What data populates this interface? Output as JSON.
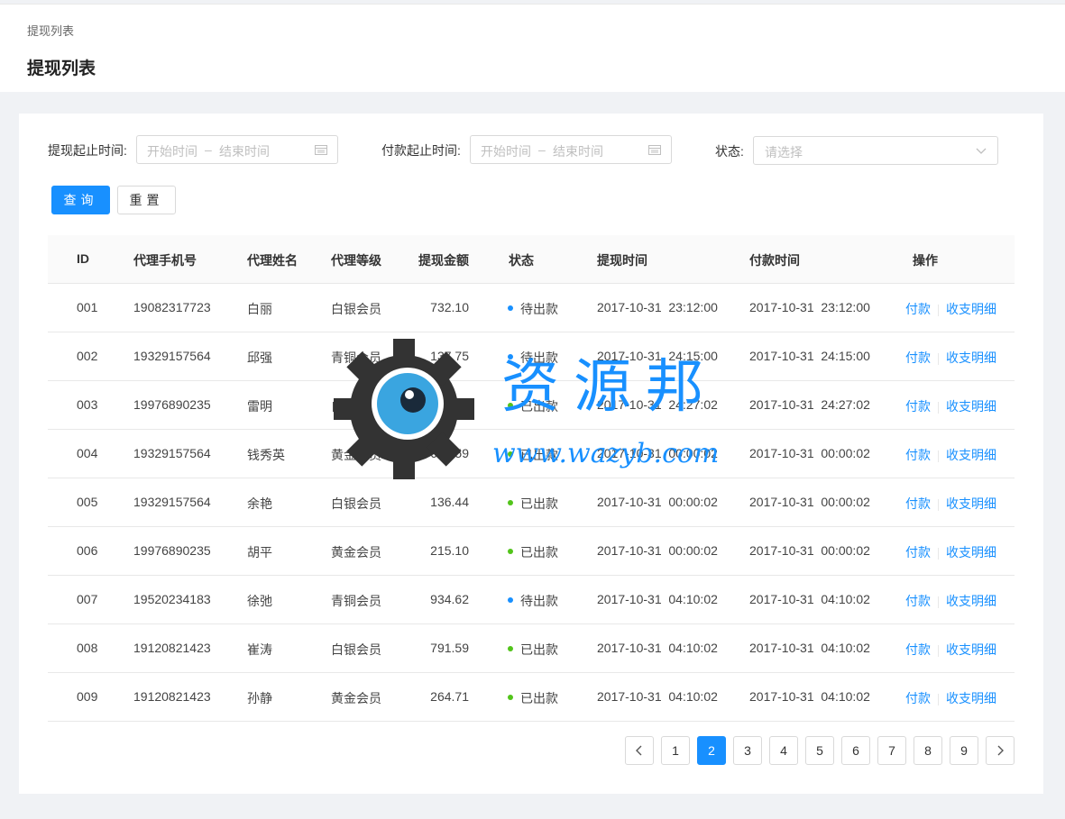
{
  "header": {
    "breadcrumb": "提现列表",
    "title": "提现列表"
  },
  "filters": {
    "withdraw_label": "提现起止时间:",
    "pay_label": "付款起止时间:",
    "status_label": "状态:",
    "start_placeholder": "开始时间",
    "separator": "–",
    "end_placeholder": "结束时间",
    "status_placeholder": "请选择"
  },
  "buttons": {
    "query": "查询",
    "reset": "重置"
  },
  "table": {
    "columns": [
      "ID",
      "代理手机号",
      "代理姓名",
      "代理等级",
      "提现金额",
      "状态",
      "提现时间",
      "付款时间",
      "操作"
    ],
    "rows": [
      {
        "id": "001",
        "phone": "19082317723",
        "name": "白丽",
        "level": "白银会员",
        "amount": "732.10",
        "status": "待出款",
        "status_color": "#1890ff",
        "withdraw_time": "2017-10-31  23:12:00",
        "pay_time": "2017-10-31  23:12:00"
      },
      {
        "id": "002",
        "phone": "19329157564",
        "name": "邱强",
        "level": "青铜会员",
        "amount": "137.75",
        "status": "待出款",
        "status_color": "#1890ff",
        "withdraw_time": "2017-10-31  24:15:00",
        "pay_time": "2017-10-31  24:15:00"
      },
      {
        "id": "003",
        "phone": "19976890235",
        "name": "雷明",
        "level": "白银会员",
        "amount": "405.98",
        "status": "已出款",
        "status_color": "#52c41a",
        "withdraw_time": "2017-10-31  24:27:02",
        "pay_time": "2017-10-31  24:27:02"
      },
      {
        "id": "004",
        "phone": "19329157564",
        "name": "钱秀英",
        "level": "黄金会员",
        "amount": "655.59",
        "status": "已出款",
        "status_color": "#52c41a",
        "withdraw_time": "2017-10-31  00:00:02",
        "pay_time": "2017-10-31  00:00:02"
      },
      {
        "id": "005",
        "phone": "19329157564",
        "name": "余艳",
        "level": "白银会员",
        "amount": "136.44",
        "status": "已出款",
        "status_color": "#52c41a",
        "withdraw_time": "2017-10-31  00:00:02",
        "pay_time": "2017-10-31  00:00:02"
      },
      {
        "id": "006",
        "phone": "19976890235",
        "name": "胡平",
        "level": "黄金会员",
        "amount": "215.10",
        "status": "已出款",
        "status_color": "#52c41a",
        "withdraw_time": "2017-10-31  00:00:02",
        "pay_time": "2017-10-31  00:00:02"
      },
      {
        "id": "007",
        "phone": "19520234183",
        "name": "徐弛",
        "level": "青铜会员",
        "amount": "934.62",
        "status": "待出款",
        "status_color": "#1890ff",
        "withdraw_time": "2017-10-31  04:10:02",
        "pay_time": "2017-10-31  04:10:02"
      },
      {
        "id": "008",
        "phone": "19120821423",
        "name": "崔涛",
        "level": "白银会员",
        "amount": "791.59",
        "status": "已出款",
        "status_color": "#52c41a",
        "withdraw_time": "2017-10-31  04:10:02",
        "pay_time": "2017-10-31  04:10:02"
      },
      {
        "id": "009",
        "phone": "19120821423",
        "name": "孙静",
        "level": "黄金会员",
        "amount": "264.71",
        "status": "已出款",
        "status_color": "#52c41a",
        "withdraw_time": "2017-10-31  04:10:02",
        "pay_time": "2017-10-31  04:10:02"
      }
    ],
    "action_pay": "付款",
    "action_detail": "收支明细"
  },
  "pagination": {
    "pages": [
      "1",
      "2",
      "3",
      "4",
      "5",
      "6",
      "7",
      "8",
      "9"
    ],
    "current": "2",
    "prev_icon": "chevron-left-icon",
    "next_icon": "chevron-right-icon"
  },
  "watermark": {
    "text": "资源邦",
    "url": "www.wazyb.com"
  },
  "colors": {
    "primary": "#1890ff",
    "pending": "#1890ff",
    "done": "#52c41a"
  }
}
